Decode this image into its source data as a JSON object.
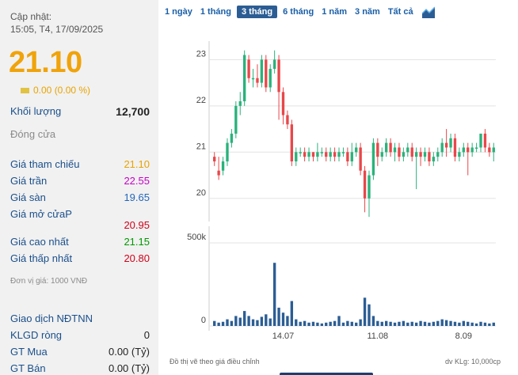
{
  "quote": {
    "updated_label": "Cập nhật:",
    "updated_time": "15:05, T4, 17/09/2025",
    "price": "21.10",
    "change": "0.00 (0.00 %)",
    "volume_label": "Khối lượng",
    "volume_value": "12,700",
    "close_label": "Đóng cửa",
    "stats": [
      {
        "label": "Giá tham chiếu",
        "value": "21.10"
      },
      {
        "label": "Giá trần",
        "value": "22.55"
      },
      {
        "label": "Giá sàn",
        "value": "19.65"
      },
      {
        "label": "Giá mở cửaP",
        "value": "20.95"
      },
      {
        "label": "Giá cao nhất",
        "value": "21.15"
      },
      {
        "label": "Giá thấp nhất",
        "value": "20.80"
      }
    ],
    "unit_note": "Đơn vị giá: 1000 VNĐ",
    "foreign": {
      "title": "Giao dịch NĐTNN",
      "rows": [
        {
          "label": "KLGD ròng",
          "value": "0"
        },
        {
          "label": "GT Mua",
          "value": "0.00 (Tỷ)"
        },
        {
          "label": "GT Bán",
          "value": "0.00 (Tỷ)"
        }
      ]
    }
  },
  "tabs": [
    "1 ngày",
    "1 tháng",
    "3 tháng",
    "6 tháng",
    "1 năm",
    "3 năm",
    "Tất cả"
  ],
  "active_tab": "3 tháng",
  "colors": {
    "up": "#2ab27b",
    "down": "#e8474a",
    "volume": "#2b5d94",
    "accent": "#f0a30a"
  },
  "footer": {
    "left": "Đồ thị vẽ theo giá điều chỉnh",
    "right": "dv KLg: 10,000cp"
  },
  "chart_data": {
    "type": "candlestick",
    "price_ticks": [
      20,
      21,
      22,
      23
    ],
    "price_range": [
      19.5,
      23.4
    ],
    "volume_ticks": [
      "0",
      "500k"
    ],
    "volume_range": [
      0,
      600000
    ],
    "x_tick_labels": [
      "14.07",
      "11.08",
      "8.09"
    ],
    "x_tick_index": [
      16,
      38,
      58
    ],
    "candles": [
      [
        20.9,
        20.8,
        21.0,
        20.7,
        30000
      ],
      [
        20.6,
        20.5,
        20.9,
        20.4,
        20000
      ],
      [
        20.6,
        20.8,
        20.9,
        20.5,
        25000
      ],
      [
        20.8,
        21.2,
        21.3,
        20.7,
        40000
      ],
      [
        21.2,
        21.4,
        21.5,
        21.1,
        30000
      ],
      [
        21.4,
        22.0,
        22.1,
        21.3,
        60000
      ],
      [
        22.0,
        22.1,
        22.3,
        21.8,
        50000
      ],
      [
        22.1,
        23.1,
        23.2,
        22.0,
        90000
      ],
      [
        23.0,
        22.6,
        23.1,
        22.5,
        60000
      ],
      [
        22.6,
        22.6,
        22.8,
        22.4,
        40000
      ],
      [
        22.6,
        22.5,
        22.9,
        22.4,
        35000
      ],
      [
        22.5,
        23.0,
        23.1,
        22.4,
        55000
      ],
      [
        23.0,
        22.4,
        23.1,
        22.3,
        70000
      ],
      [
        22.4,
        22.8,
        22.9,
        22.3,
        45000
      ],
      [
        22.8,
        23.0,
        23.2,
        22.7,
        380000
      ],
      [
        23.0,
        22.3,
        23.1,
        21.7,
        110000
      ],
      [
        22.3,
        21.8,
        22.4,
        21.6,
        80000
      ],
      [
        21.8,
        21.6,
        21.9,
        21.5,
        60000
      ],
      [
        21.6,
        20.8,
        21.7,
        20.7,
        150000
      ],
      [
        20.8,
        21.0,
        21.1,
        20.7,
        40000
      ],
      [
        21.0,
        21.0,
        21.1,
        20.9,
        25000
      ],
      [
        21.0,
        20.9,
        21.1,
        20.8,
        30000
      ],
      [
        20.9,
        21.0,
        21.1,
        20.8,
        20000
      ],
      [
        21.0,
        20.9,
        21.0,
        20.8,
        25000
      ],
      [
        20.9,
        21.0,
        21.2,
        20.8,
        20000
      ],
      [
        21.0,
        21.0,
        21.1,
        20.9,
        15000
      ],
      [
        21.0,
        20.9,
        21.1,
        20.8,
        20000
      ],
      [
        20.9,
        21.0,
        21.1,
        20.8,
        25000
      ],
      [
        21.0,
        20.9,
        21.1,
        20.8,
        30000
      ],
      [
        20.9,
        21.0,
        21.1,
        20.8,
        60000
      ],
      [
        21.0,
        21.0,
        21.1,
        20.9,
        20000
      ],
      [
        21.0,
        20.8,
        21.1,
        20.7,
        30000
      ],
      [
        20.8,
        21.0,
        21.2,
        20.7,
        25000
      ],
      [
        21.0,
        21.1,
        21.2,
        20.9,
        20000
      ],
      [
        21.1,
        20.6,
        21.2,
        20.5,
        40000
      ],
      [
        20.6,
        20.0,
        20.7,
        19.7,
        170000
      ],
      [
        20.0,
        20.5,
        20.6,
        19.6,
        130000
      ],
      [
        20.5,
        21.2,
        21.3,
        20.4,
        60000
      ],
      [
        21.2,
        20.9,
        21.3,
        20.7,
        30000
      ],
      [
        20.9,
        21.0,
        21.1,
        20.8,
        25000
      ],
      [
        21.0,
        21.2,
        21.3,
        20.9,
        30000
      ],
      [
        21.2,
        21.0,
        21.3,
        20.9,
        25000
      ],
      [
        21.0,
        21.1,
        21.2,
        20.8,
        20000
      ],
      [
        21.1,
        20.9,
        21.2,
        20.8,
        25000
      ],
      [
        20.9,
        21.0,
        21.1,
        20.8,
        30000
      ],
      [
        21.0,
        21.1,
        21.2,
        20.9,
        20000
      ],
      [
        21.1,
        20.9,
        21.2,
        20.8,
        25000
      ],
      [
        20.9,
        21.0,
        21.1,
        20.2,
        20000
      ],
      [
        21.0,
        20.9,
        21.1,
        20.7,
        30000
      ],
      [
        20.9,
        21.0,
        21.1,
        20.8,
        25000
      ],
      [
        21.0,
        20.8,
        21.1,
        20.7,
        20000
      ],
      [
        20.8,
        20.9,
        21.0,
        20.7,
        25000
      ],
      [
        20.9,
        21.0,
        21.1,
        20.8,
        30000
      ],
      [
        21.0,
        21.2,
        21.3,
        20.9,
        40000
      ],
      [
        21.2,
        21.1,
        21.5,
        20.9,
        35000
      ],
      [
        21.1,
        21.3,
        21.4,
        21.0,
        30000
      ],
      [
        21.3,
        20.9,
        21.4,
        20.8,
        25000
      ],
      [
        20.9,
        21.0,
        21.1,
        20.8,
        20000
      ],
      [
        21.0,
        21.1,
        21.2,
        20.9,
        30000
      ],
      [
        21.1,
        21.0,
        21.2,
        20.5,
        25000
      ],
      [
        21.0,
        21.1,
        21.2,
        20.9,
        20000
      ],
      [
        21.1,
        21.1,
        21.2,
        21.0,
        15000
      ],
      [
        21.1,
        21.4,
        21.4,
        21.0,
        25000
      ],
      [
        21.4,
        21.1,
        21.5,
        21.0,
        20000
      ],
      [
        21.1,
        21.0,
        21.2,
        20.9,
        15000
      ],
      [
        21.0,
        21.1,
        21.2,
        20.8,
        20000
      ]
    ]
  }
}
